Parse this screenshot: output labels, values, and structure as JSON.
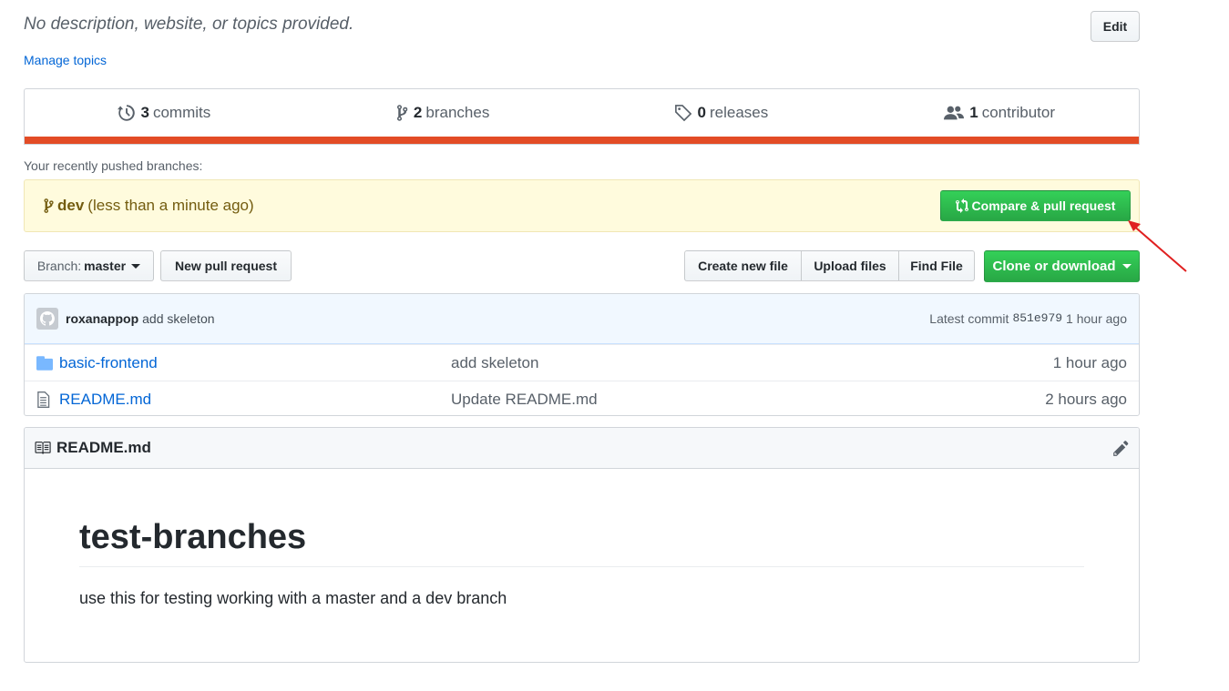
{
  "repo": {
    "description": "No description, website, or topics provided.",
    "manage_topics": "Manage topics",
    "edit_label": "Edit"
  },
  "summary": {
    "commits": {
      "count": "3",
      "label": "commits"
    },
    "branches": {
      "count": "2",
      "label": "branches"
    },
    "releases": {
      "count": "0",
      "label": "releases"
    },
    "contributors": {
      "count": "1",
      "label": "contributor"
    },
    "language_bar_color": "#e34c26"
  },
  "recent": {
    "label": "Your recently pushed branches:",
    "branch": "dev",
    "time": "(less than a minute ago)",
    "compare_label": "Compare & pull request"
  },
  "toolbar": {
    "branch_prefix": "Branch:",
    "branch_value": "master",
    "new_pr": "New pull request",
    "create_file": "Create new file",
    "upload_files": "Upload files",
    "find_file": "Find File",
    "clone": "Clone or download"
  },
  "commit": {
    "author": "roxanappop",
    "message": "add skeleton",
    "latest_label": "Latest commit",
    "sha": "851e979",
    "age": "1 hour ago"
  },
  "files": [
    {
      "name": "basic-frontend",
      "type": "folder",
      "message": "add skeleton",
      "age": "1 hour ago"
    },
    {
      "name": "README.md",
      "type": "file",
      "message": "Update README.md",
      "age": "2 hours ago"
    }
  ],
  "readme": {
    "filename": "README.md",
    "heading": "test-branches",
    "paragraph": "use this for testing working with a master and a dev branch"
  },
  "colors": {
    "accent_green": "#28a745",
    "link_blue": "#0366d6",
    "annotation_arrow": "#e02020"
  }
}
